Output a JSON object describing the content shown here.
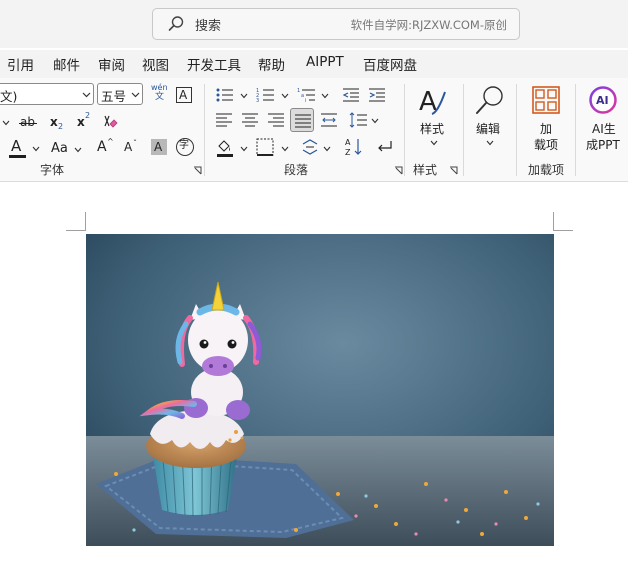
{
  "search": {
    "placeholder": "搜索",
    "watermark": "软件自学网:RJZXW.COM-原创"
  },
  "menu_tabs": [
    "引用",
    "邮件",
    "审阅",
    "视图",
    "开发工具",
    "帮助",
    "AIPPT",
    "百度网盘"
  ],
  "font_group": {
    "font_name_value": "文)",
    "font_size_value": "五号",
    "phonetic_top": "wén",
    "phonetic_bottom": "文",
    "char_border": "A",
    "strike": "ab",
    "subscript_base": "x",
    "subscript_mark": "2",
    "superscript_base": "x",
    "superscript_mark": "2",
    "font_color": "A",
    "change_case": "Aa",
    "grow_font": "A",
    "shrink_font": "A",
    "char_shading": "A",
    "enclose_char": "字",
    "label": "字体"
  },
  "paragraph_group": {
    "label": "段落"
  },
  "styles_group": {
    "button_label": "样式",
    "label": "样式"
  },
  "editing_group": {
    "button_label": "编辑"
  },
  "addins_group": {
    "button_label_1": "加",
    "button_label_2": "载项",
    "label": "加载项"
  },
  "aippt_group": {
    "icon_text": "AI",
    "button_label_1": "AI生",
    "button_label_2": "成PPT"
  },
  "colors": {
    "accent": "#2b579a",
    "font_color_bar": "#1f1f1f",
    "addins_orange": "#d35a1f",
    "ai_purple": "#7b3fe4",
    "ai_pink": "#e0359a"
  },
  "document": {
    "image": "cupcake-with-unicorn-topper"
  }
}
